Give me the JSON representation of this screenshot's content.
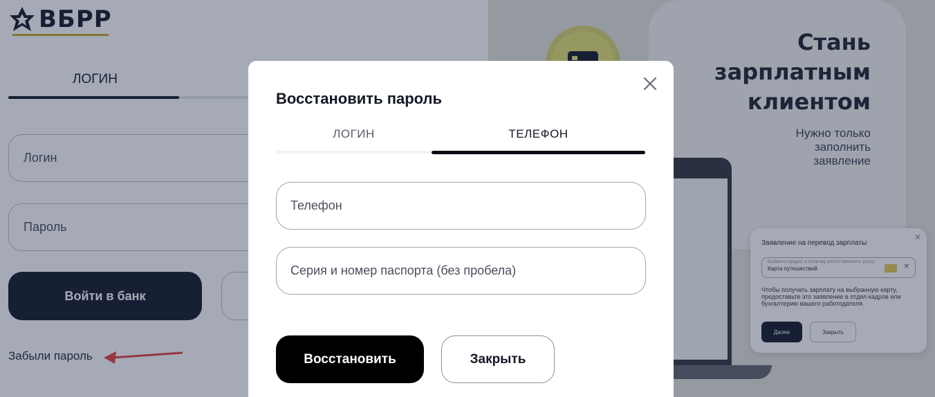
{
  "background": {
    "logo": {
      "text": "ВБРР",
      "brand_color": "#0b1120",
      "accent_color": "#c9a227"
    },
    "tabs": {
      "login": "ЛОГИН"
    },
    "fields": {
      "login_placeholder": "Логин",
      "password_placeholder": "Пароль"
    },
    "enter_button": "Войти в банк",
    "forgot_link": "Забыли пароль",
    "promo": {
      "title_line1": "Стань",
      "title_line2": "зарплатным",
      "title_line3": "клиентом",
      "subtitle_line1": "Нужно только",
      "subtitle_line2": "заполнить",
      "subtitle_line3": "заявление"
    },
    "mini_card": {
      "title": "Заявление на перевод зарплаты",
      "select_hint": "Выберите продукт, к которому хотите применить услугу",
      "select_value": "Карта путешествий",
      "text": "Чтобы получать зарплату на выбранную карту, предоставьте это заявление в отдел кадров или бухгалтерию вашего работодателя.",
      "next_button": "Далее",
      "close_button": "Закрыть"
    }
  },
  "modal": {
    "title": "Восстановить пароль",
    "tabs": [
      {
        "label": "ЛОГИН",
        "active": false
      },
      {
        "label": "ТЕЛЕФОН",
        "active": true
      }
    ],
    "phone_placeholder": "Телефон",
    "passport_placeholder": "Серия и номер паспорта (без пробела)",
    "restore_button": "Восстановить",
    "close_button": "Закрыть",
    "close_icon": "close-icon"
  }
}
